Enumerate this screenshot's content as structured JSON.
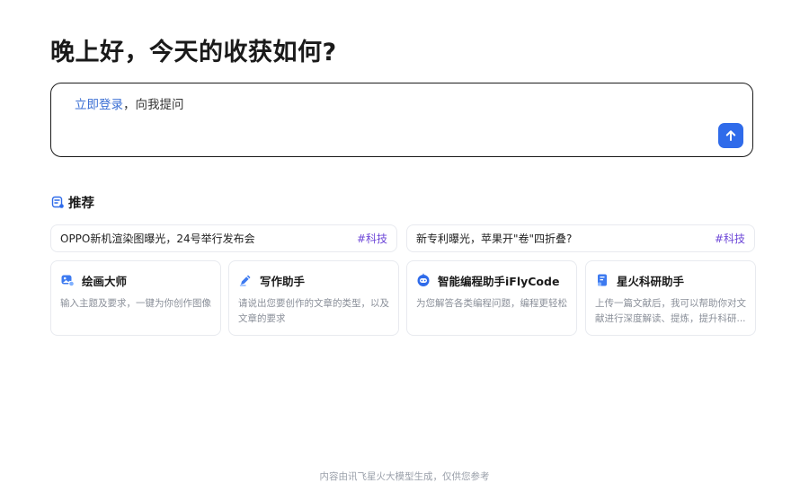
{
  "greeting": "晚上好，今天的收获如何?",
  "ask_box": {
    "login_link": "立即登录",
    "prompt_text": "，向我提问",
    "send_label": "发送"
  },
  "recommend": {
    "title": "推荐",
    "news": [
      {
        "text": "OPPO新机渲染图曝光，24号举行发布会",
        "tag": "#科技"
      },
      {
        "text": "新专利曝光，苹果开\"卷\"四折叠?",
        "tag": "#科技"
      }
    ],
    "cards": [
      {
        "title": "绘画大师",
        "desc": "输入主题及要求，一键为你创作图像",
        "icon": "image-icon"
      },
      {
        "title": "写作助手",
        "desc": "请说出您要创作的文章的类型，以及文章的要求",
        "icon": "pen-icon"
      },
      {
        "title": "智能编程助手iFlyCode",
        "desc": "为您解答各类编程问题，编程更轻松",
        "icon": "robot-icon"
      },
      {
        "title": "星火科研助手",
        "desc": "上传一篇文献后，我可以帮助你对文献进行深度解读、提炼，提升科研...",
        "icon": "document-icon"
      }
    ]
  },
  "footer": "内容由讯飞星火大模型生成，仅供您参考",
  "colors": {
    "accent": "#2f6bea",
    "link": "#3b6fd4",
    "tag": "#6e48d8"
  }
}
